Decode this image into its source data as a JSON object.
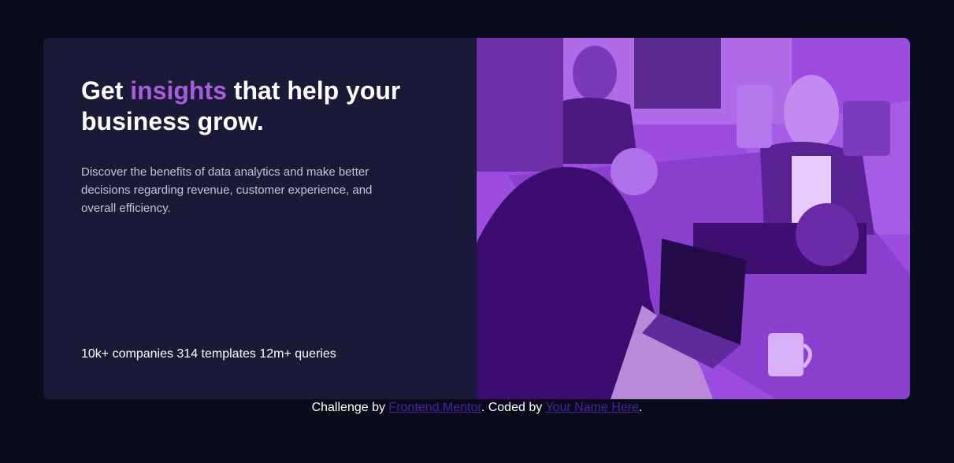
{
  "card": {
    "headline_prefix": "Get ",
    "headline_accent": "insights",
    "headline_suffix": " that help your business grow.",
    "description": "Discover the benefits of data analytics and make better decisions regarding revenue, customer experience, and overall efficiency.",
    "stats": "10k+ companies 314 templates 12m+ queries"
  },
  "attribution": {
    "prefix": "Challenge by ",
    "link1": "Frontend Mentor",
    "middle": ". Coded by ",
    "link2": "Your Name Here",
    "suffix": "."
  },
  "colors": {
    "page_background": "#090b1a",
    "card_background": "#1b1938",
    "accent": "#aa5cdb",
    "photo_tint": "#9c4ce0",
    "link": "#4c22a2"
  },
  "image": {
    "icon": "office-team-photo"
  }
}
